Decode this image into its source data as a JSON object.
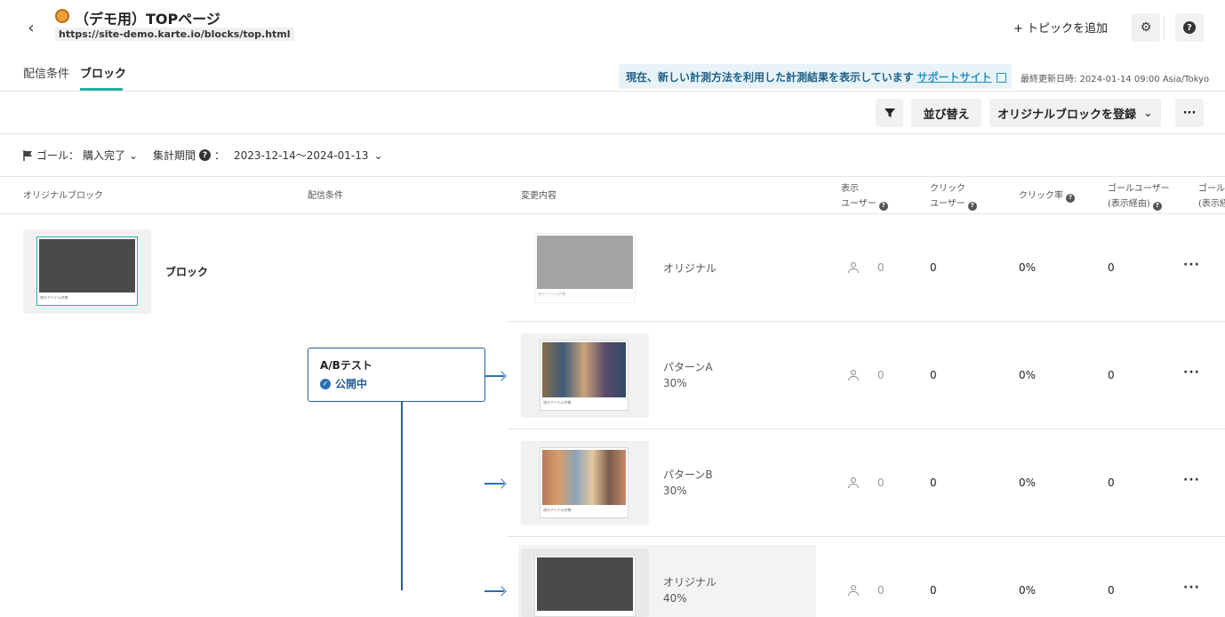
{
  "header": {
    "title": "（デモ用）TOPページ",
    "url": "https://site-demo.karte.io/blocks/top.html",
    "back_icon": "chevron-left-icon",
    "add_topic": "+ トピックを追加",
    "settings_icon": "⚙",
    "help_icon": "?"
  },
  "tabs": [
    {
      "label": "配信条件",
      "active": false
    },
    {
      "label": "ブロック",
      "active": true
    }
  ],
  "banner": {
    "text": "現在、新しい計測方法を利用した計測結果を表示しています",
    "link": "サポートサイト",
    "updated": "最終更新日時: 2024-01-14 09:00 Asia/Tokyo"
  },
  "toolbar": {
    "filter_icon": "filter-icon",
    "sort": "並び替え",
    "register": "オリジナルブロックを登録",
    "more": "···"
  },
  "filters": {
    "goal_label": "ゴール：",
    "goal_value": "購入完了",
    "period_label": "集計期間",
    "period_sep": "：",
    "period_value": "2023-12-14〜2024-01-13"
  },
  "columns": {
    "original_block": "オリジナルブロック",
    "conditions": "配信条件",
    "changes": "変更内容",
    "display_1": "表示",
    "display_2": "ユーザー",
    "click_1": "クリック",
    "click_2": "ユーザー",
    "click_rate": "クリック率",
    "goal_1": "ゴールユーザー",
    "goal_2": "(表示経由)",
    "goal2_1": "ゴール",
    "goal2_2": "(表示経"
  },
  "block": {
    "name": "ブロック",
    "thumb_caption": "旅のアイテム特集"
  },
  "abtest": {
    "title": "A/Bテスト",
    "status": "公開中"
  },
  "rows": [
    {
      "label": "オリジナル",
      "ratio": "",
      "display": "0",
      "click": "0",
      "rate": "0%",
      "goal": "0",
      "more": "···"
    },
    {
      "label": "パターンA",
      "ratio": "30%",
      "display": "0",
      "click": "0",
      "rate": "0%",
      "goal": "0",
      "more": "···"
    },
    {
      "label": "パターンB",
      "ratio": "30%",
      "display": "0",
      "click": "0",
      "rate": "0%",
      "goal": "0",
      "more": "···"
    },
    {
      "label": "オリジナル",
      "ratio": "40%",
      "display": "0",
      "click": "0",
      "rate": "0%",
      "goal": "0",
      "more": "···"
    }
  ],
  "colors": {
    "accent": "#2bb0a5",
    "link": "#2a91c2",
    "ab_border": "#2a5f93"
  }
}
